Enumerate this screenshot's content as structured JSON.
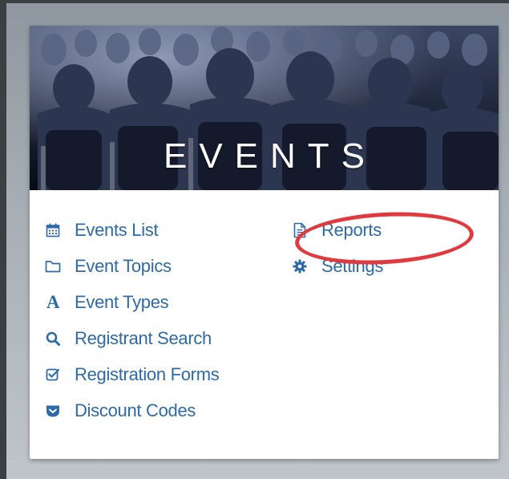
{
  "banner": {
    "title": "EVENTS"
  },
  "menu": {
    "left": [
      {
        "label": "Events List",
        "icon": "calendar-icon"
      },
      {
        "label": "Event Topics",
        "icon": "folder-icon"
      },
      {
        "label": "Event Types",
        "icon": "letter-a-icon"
      },
      {
        "label": "Registrant Search",
        "icon": "search-icon"
      },
      {
        "label": "Registration Forms",
        "icon": "checkbox-icon"
      },
      {
        "label": "Discount Codes",
        "icon": "tag-pocket-icon"
      }
    ],
    "right": [
      {
        "label": "Reports",
        "icon": "document-icon"
      },
      {
        "label": "Settings",
        "icon": "gear-icon"
      }
    ]
  },
  "colors": {
    "link": "#2c6aa8",
    "highlight": "#e03a3e",
    "banner_bg": "#0f1524"
  }
}
